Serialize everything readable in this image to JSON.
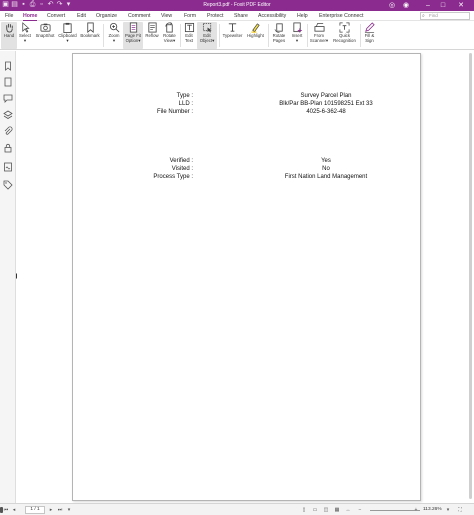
{
  "window": {
    "title": "Report3.pdf - Foxit PDF Editor"
  },
  "tabs": [
    "File",
    "Home",
    "Convert",
    "Edit",
    "Organize",
    "Comment",
    "View",
    "Form",
    "Protect",
    "Share",
    "Accessibility",
    "Help",
    "Enterprise Connect"
  ],
  "active_tab": "Home",
  "search": {
    "placeholder": "Find"
  },
  "ribbon": {
    "hand": "Hand",
    "select": "Select",
    "snapshot": "SnapShot",
    "clipboard": "Clipboard",
    "bookmark": "Bookmark",
    "zoom": "Zoom",
    "page_fit_1": "Page Fit",
    "page_fit_2": "Option",
    "reflow": "Reflow",
    "rotate_view_1": "Rotate",
    "rotate_view_2": "View",
    "edit_text_1": "Edit",
    "edit_text_2": "Text",
    "edit_object_1": "Edit",
    "edit_object_2": "Object",
    "typewriter": "Typewriter",
    "highlight": "Highlight",
    "rotate_pages_1": "Rotate",
    "rotate_pages_2": "Pages",
    "insert": "Insert",
    "from_scanner_1": "From",
    "from_scanner_2": "Scanner",
    "quick_recognition_1": "Quick",
    "quick_recognition_2": "Recognition",
    "fill_sign_1": "Fill &",
    "fill_sign_2": "Sign"
  },
  "document": {
    "type_label": "Type :",
    "type_value": "Survey Parcel Plan",
    "lld_label": "LLD :",
    "lld_value": "Blk/Par BB-Plan 101598251 Ext 33",
    "file_number_label": "File Number :",
    "file_number_value": "4025-6-362-48",
    "verified_label": "Verified :",
    "verified_value": "Yes",
    "visited_label": "Visited :",
    "visited_value": "No",
    "process_type_label": "Process Type :",
    "process_type_value": "First Nation Land Management"
  },
  "status": {
    "page_indicator": "1 / 1",
    "zoom_level": "113.26%"
  },
  "colors": {
    "brand": "#8b2b8f",
    "active_tool_bg": "#e2e2e2"
  }
}
